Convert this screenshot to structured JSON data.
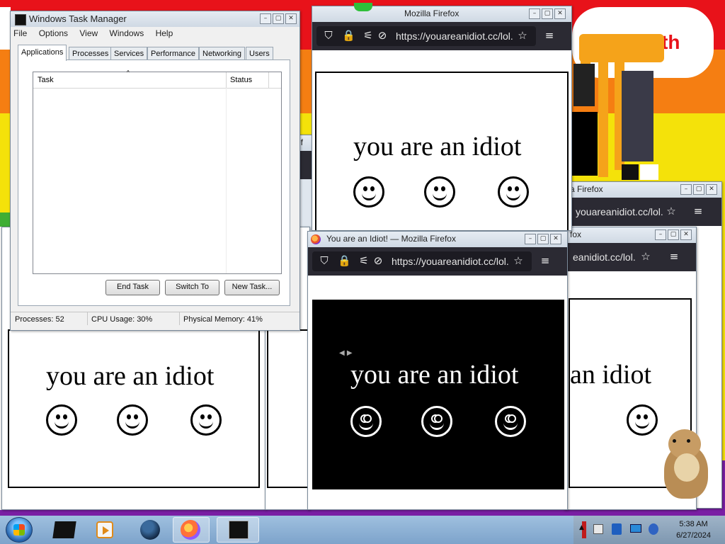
{
  "desktop": {
    "bg_banner_text": "month"
  },
  "taskmgr": {
    "title": "Windows Task Manager",
    "menu": [
      "File",
      "Options",
      "View",
      "Windows",
      "Help"
    ],
    "tabs": [
      "Applications",
      "Processes",
      "Services",
      "Performance",
      "Networking",
      "Users"
    ],
    "active_tab": "Applications",
    "columns": [
      "Task",
      "Status"
    ],
    "buttons": {
      "end_task": "End Task",
      "switch_to": "Switch To",
      "new_task": "New Task..."
    },
    "status": {
      "processes": "Processes: 52",
      "cpu": "CPU Usage: 30%",
      "memory": "Physical Memory: 41%"
    }
  },
  "firefox": {
    "window_title_full": "You are an Idiot! — Mozilla Firefox",
    "window_title_short": "Mozilla Firefox",
    "window_title_frag1": "a Firefox",
    "window_title_frag2": "fox",
    "window_title_frag3": "ef",
    "url": "https://youareanidiot.cc/lol.",
    "url_short": "youareanidiot.cc/lol.",
    "url_frag": "eanidiot.cc/lol.",
    "page_text": "you are an idiot",
    "page_text_partial": "an idiot"
  },
  "taskbar": {
    "clock_time": "5:38 AM",
    "clock_date": "6/27/2024"
  },
  "colors": {
    "fx_toolbar": "#2b2a33",
    "taskbar": "#8fb2d6"
  }
}
